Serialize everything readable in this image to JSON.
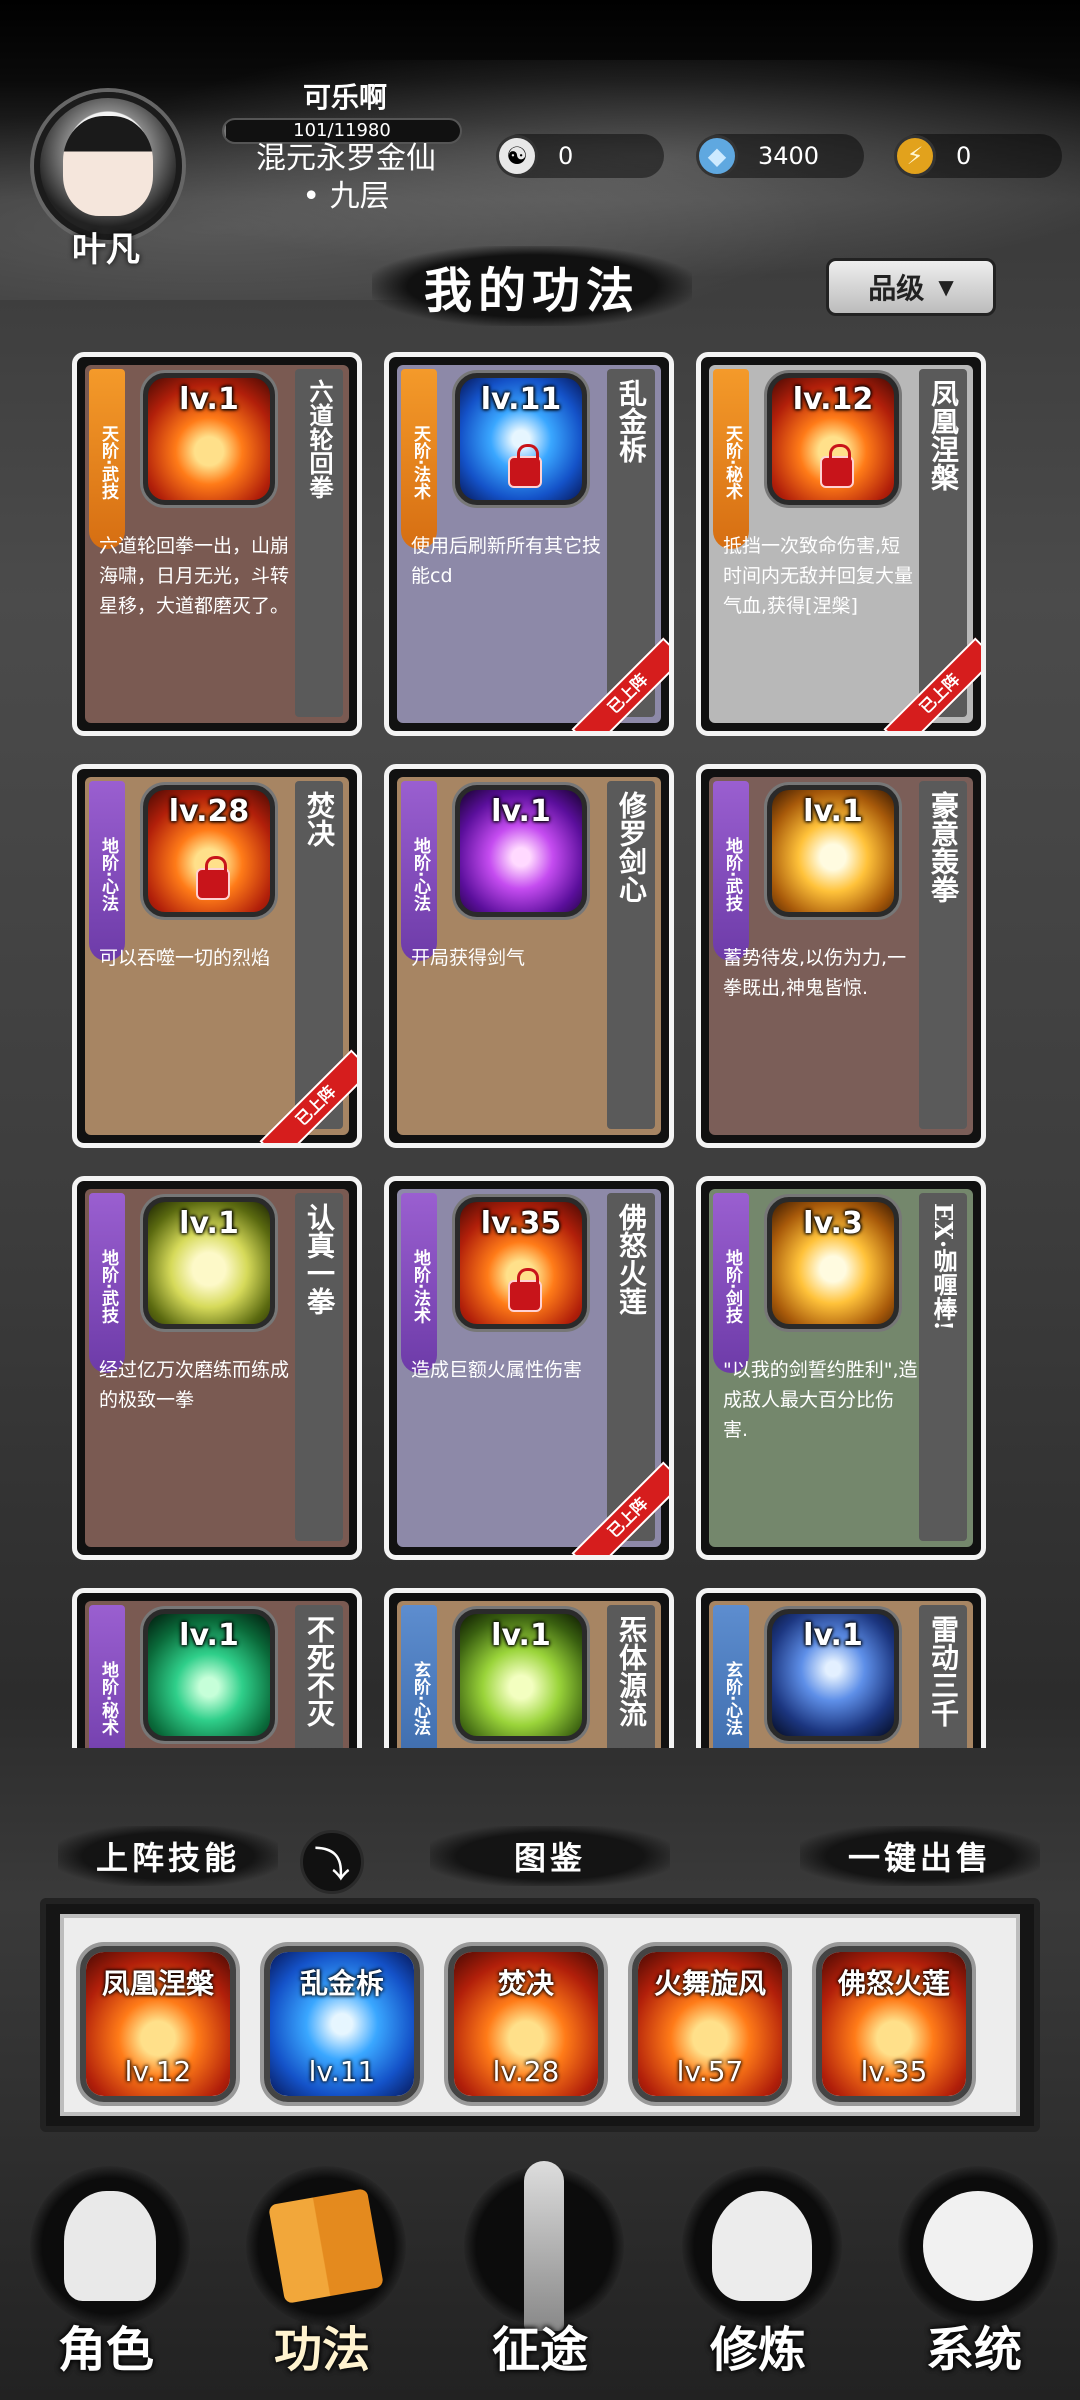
{
  "header": {
    "player_name": "叶凡",
    "nickname": "可乐啊",
    "exp_text": "101/11980",
    "exp_fraction": 0.0084,
    "realm_line1": "混元永罗金仙",
    "realm_line2": "• 九层",
    "resources": [
      {
        "icon": "yin-yang-icon",
        "value": "0"
      },
      {
        "icon": "crystal-gem-icon",
        "value": "3400"
      },
      {
        "icon": "lightning-icon",
        "value": "0"
      }
    ]
  },
  "section_title": "我的功法",
  "sort_button": {
    "label": "品级",
    "icon": "chevron-down-icon"
  },
  "skills": [
    {
      "grade": "天阶·武技",
      "grade_color": "orange",
      "level": "lv.1",
      "name": "六道轮回拳",
      "desc": "六道轮回拳一出，山崩海啸，日月无光，斗转星移，大道都磨灭了。",
      "bg": "brown",
      "art": "fire",
      "locked": false,
      "equipped": false
    },
    {
      "grade": "天阶·法术",
      "grade_color": "orange",
      "level": "lv.11",
      "name": "乱金柝",
      "desc": "使用后刷新所有其它技能cd",
      "bg": "lav",
      "art": "hex",
      "locked": true,
      "equipped": true
    },
    {
      "grade": "天阶·秘术",
      "grade_color": "orange",
      "level": "lv.12",
      "name": "凤凰涅槃",
      "desc": "抵挡一次致命伤害,短时间内无敌并回复大量气血,获得[涅槃]",
      "bg": "grey",
      "art": "fire",
      "locked": true,
      "equipped": true
    },
    {
      "grade": "地阶·心法",
      "grade_color": "purple",
      "level": "lv.28",
      "name": "焚决",
      "desc": "可以吞噬一切的烈焰",
      "bg": "tan",
      "art": "fire",
      "locked": true,
      "equipped": true
    },
    {
      "grade": "地阶·心法",
      "grade_color": "purple",
      "level": "lv.1",
      "name": "修罗剑心",
      "desc": "开局获得剑气",
      "bg": "tan",
      "art": "purple",
      "locked": false,
      "equipped": false
    },
    {
      "grade": "地阶·武技",
      "grade_color": "purple",
      "level": "lv.1",
      "name": "豪意轰拳",
      "desc": "蓄势待发,以伤为力,一拳既出,神鬼皆惊.",
      "bg": "rose",
      "art": "gold",
      "locked": false,
      "equipped": false
    },
    {
      "grade": "地阶·武技",
      "grade_color": "purple",
      "level": "lv.1",
      "name": "认真一拳",
      "desc": "经过亿万次磨练而练成的极致一拳",
      "bg": "brown",
      "art": "fist",
      "locked": false,
      "equipped": false
    },
    {
      "grade": "地阶·法术",
      "grade_color": "purple",
      "level": "lv.35",
      "name": "佛怒火莲",
      "desc": "造成巨额火属性伤害",
      "bg": "lav",
      "art": "fire",
      "locked": true,
      "equipped": true
    },
    {
      "grade": "地阶·剑技",
      "grade_color": "purple",
      "level": "lv.3",
      "name": "EX·咖喱棒!",
      "desc": "\"以我的剑誓约胜利\",造成敌人最大百分比伤害.",
      "bg": "sage",
      "art": "gold",
      "locked": false,
      "equipped": false
    },
    {
      "grade": "地阶·秘术",
      "grade_color": "purple",
      "level": "lv.1",
      "name": "不死不灭",
      "desc": "",
      "bg": "brown",
      "art": "green",
      "locked": false,
      "equipped": false
    },
    {
      "grade": "玄阶·心法",
      "grade_color": "blue",
      "level": "lv.1",
      "name": "炁体源流",
      "desc": "",
      "bg": "tan",
      "art": "lime",
      "locked": false,
      "equipped": false
    },
    {
      "grade": "玄阶·心法",
      "grade_color": "blue",
      "level": "lv.1",
      "name": "雷动三千",
      "desc": "",
      "bg": "tan",
      "art": "storm",
      "locked": false,
      "equipped": false
    }
  ],
  "equipped_ribbon_text": "已上阵",
  "controls": {
    "deployed_label": "上阵技能",
    "toggle_icon": "arrow-down-icon",
    "codex_label": "图鉴",
    "sell_label": "一键出售"
  },
  "equipped_slots": [
    {
      "name": "凤凰涅槃",
      "level": "lv.12",
      "art": "fire"
    },
    {
      "name": "乱金柝",
      "level": "lv.11",
      "art": "hex"
    },
    {
      "name": "焚决",
      "level": "lv.28",
      "art": "fire"
    },
    {
      "name": "火舞旋风",
      "level": "lv.57",
      "art": "fire"
    },
    {
      "name": "佛怒火莲",
      "level": "lv.35",
      "art": "fire"
    }
  ],
  "nav": [
    {
      "label": "角色",
      "icon": "character-icon",
      "active": false
    },
    {
      "label": "功法",
      "icon": "skill-book-icon",
      "active": true
    },
    {
      "label": "征途",
      "icon": "sword-journey-icon",
      "active": false
    },
    {
      "label": "修炼",
      "icon": "meditation-icon",
      "active": false
    },
    {
      "label": "系统",
      "icon": "system-icon",
      "active": false
    }
  ]
}
